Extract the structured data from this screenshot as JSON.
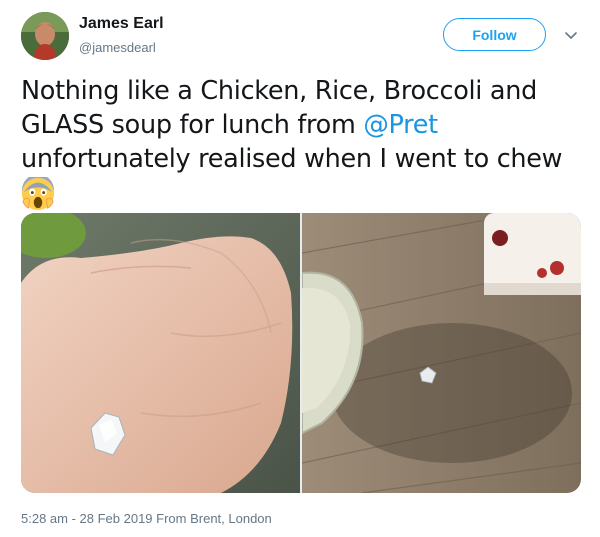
{
  "user": {
    "name": "James Earl",
    "handle": "@jamesdearl",
    "avatar_icon": "profile-photo"
  },
  "follow_label": "Follow",
  "tweet": {
    "text_before_mention": "Nothing like a Chicken, Rice, Broccoli and GLASS soup for lunch from ",
    "mention": "@Pret",
    "text_after_mention": " unfortunately realised when I went to chew",
    "emoji_icon": "face-screaming-in-fear-icon"
  },
  "photos": [
    {
      "icon": "hand-holding-glass-shard-photo"
    },
    {
      "icon": "glass-shard-on-table-photo"
    }
  ],
  "timestamp": "5:28 am - 28 Feb 2019 From Brent, London",
  "colors": {
    "accent": "#1da1f2",
    "mention": "#1b95e0",
    "secondary_text": "#657786"
  }
}
